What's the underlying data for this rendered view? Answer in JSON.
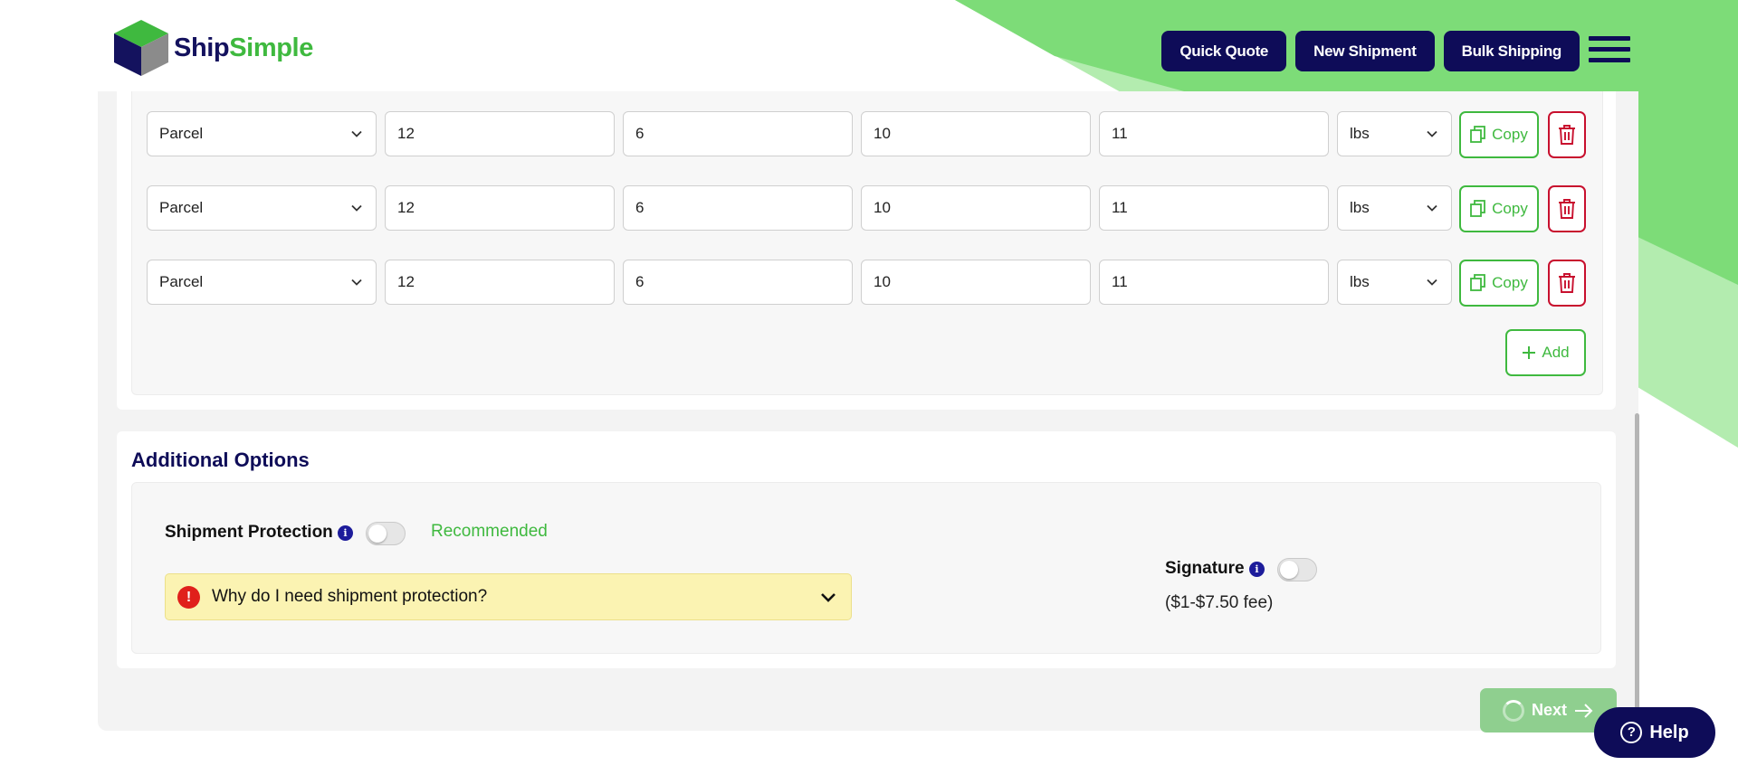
{
  "brand": {
    "logo_ship": "Ship",
    "logo_simple": "Simple",
    "colors": {
      "navy": "#0e0c58",
      "green": "#3fb93f",
      "red": "#c8102e"
    }
  },
  "header": {
    "buttons": [
      "Quick Quote",
      "New Shipment",
      "Bulk Shipping"
    ],
    "menu_icon": "hamburger-menu-icon"
  },
  "packages": {
    "rows": [
      {
        "type": "Parcel",
        "length": "12",
        "width": "6",
        "height": "10",
        "weight": "11",
        "unit": "lbs",
        "copy_label": "Copy"
      },
      {
        "type": "Parcel",
        "length": "12",
        "width": "6",
        "height": "10",
        "weight": "11",
        "unit": "lbs",
        "copy_label": "Copy"
      },
      {
        "type": "Parcel",
        "length": "12",
        "width": "6",
        "height": "10",
        "weight": "11",
        "unit": "lbs",
        "copy_label": "Copy"
      }
    ],
    "add_label": "Add"
  },
  "additional_options": {
    "title": "Additional Options",
    "shipment_protection": {
      "label": "Shipment Protection",
      "enabled": false,
      "recommended": "Recommended",
      "why_text": "Why do I need shipment protection?"
    },
    "signature": {
      "label": "Signature",
      "enabled": false,
      "fee": "($1-$7.50 fee)"
    }
  },
  "footer": {
    "next_label": "Next",
    "help_label": "Help"
  }
}
